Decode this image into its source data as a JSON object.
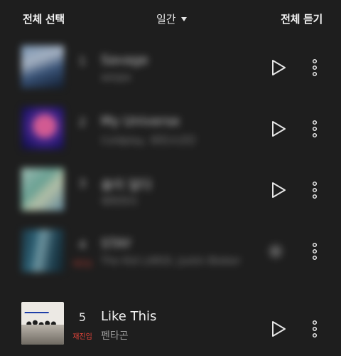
{
  "header": {
    "select_all": "전체 선택",
    "period": "일간",
    "play_all": "전체 듣기"
  },
  "tracks": [
    {
      "rank": "1",
      "title": "Savage",
      "artist": "aespa",
      "badge": "",
      "blurred": true
    },
    {
      "rank": "2",
      "title": "My Universe",
      "artist": "Coldplay, 방탄소년단",
      "badge": "",
      "blurred": true
    },
    {
      "rank": "3",
      "title": "술이 달다",
      "artist": "에픽하이",
      "badge": "",
      "blurred": true
    },
    {
      "rank": "4",
      "title": "STAY",
      "artist": "The Kid LAROI, Justin Bieber",
      "badge": "재진입",
      "blurred": true
    },
    {
      "rank": "5",
      "title": "Like This",
      "artist": "펜타곤",
      "badge": "재진입",
      "blurred": false
    }
  ],
  "icons": {
    "play": "play-icon",
    "more": "more-vertical-icon"
  },
  "colors": {
    "background": "#1e1e1e",
    "badge": "#e9453a"
  }
}
